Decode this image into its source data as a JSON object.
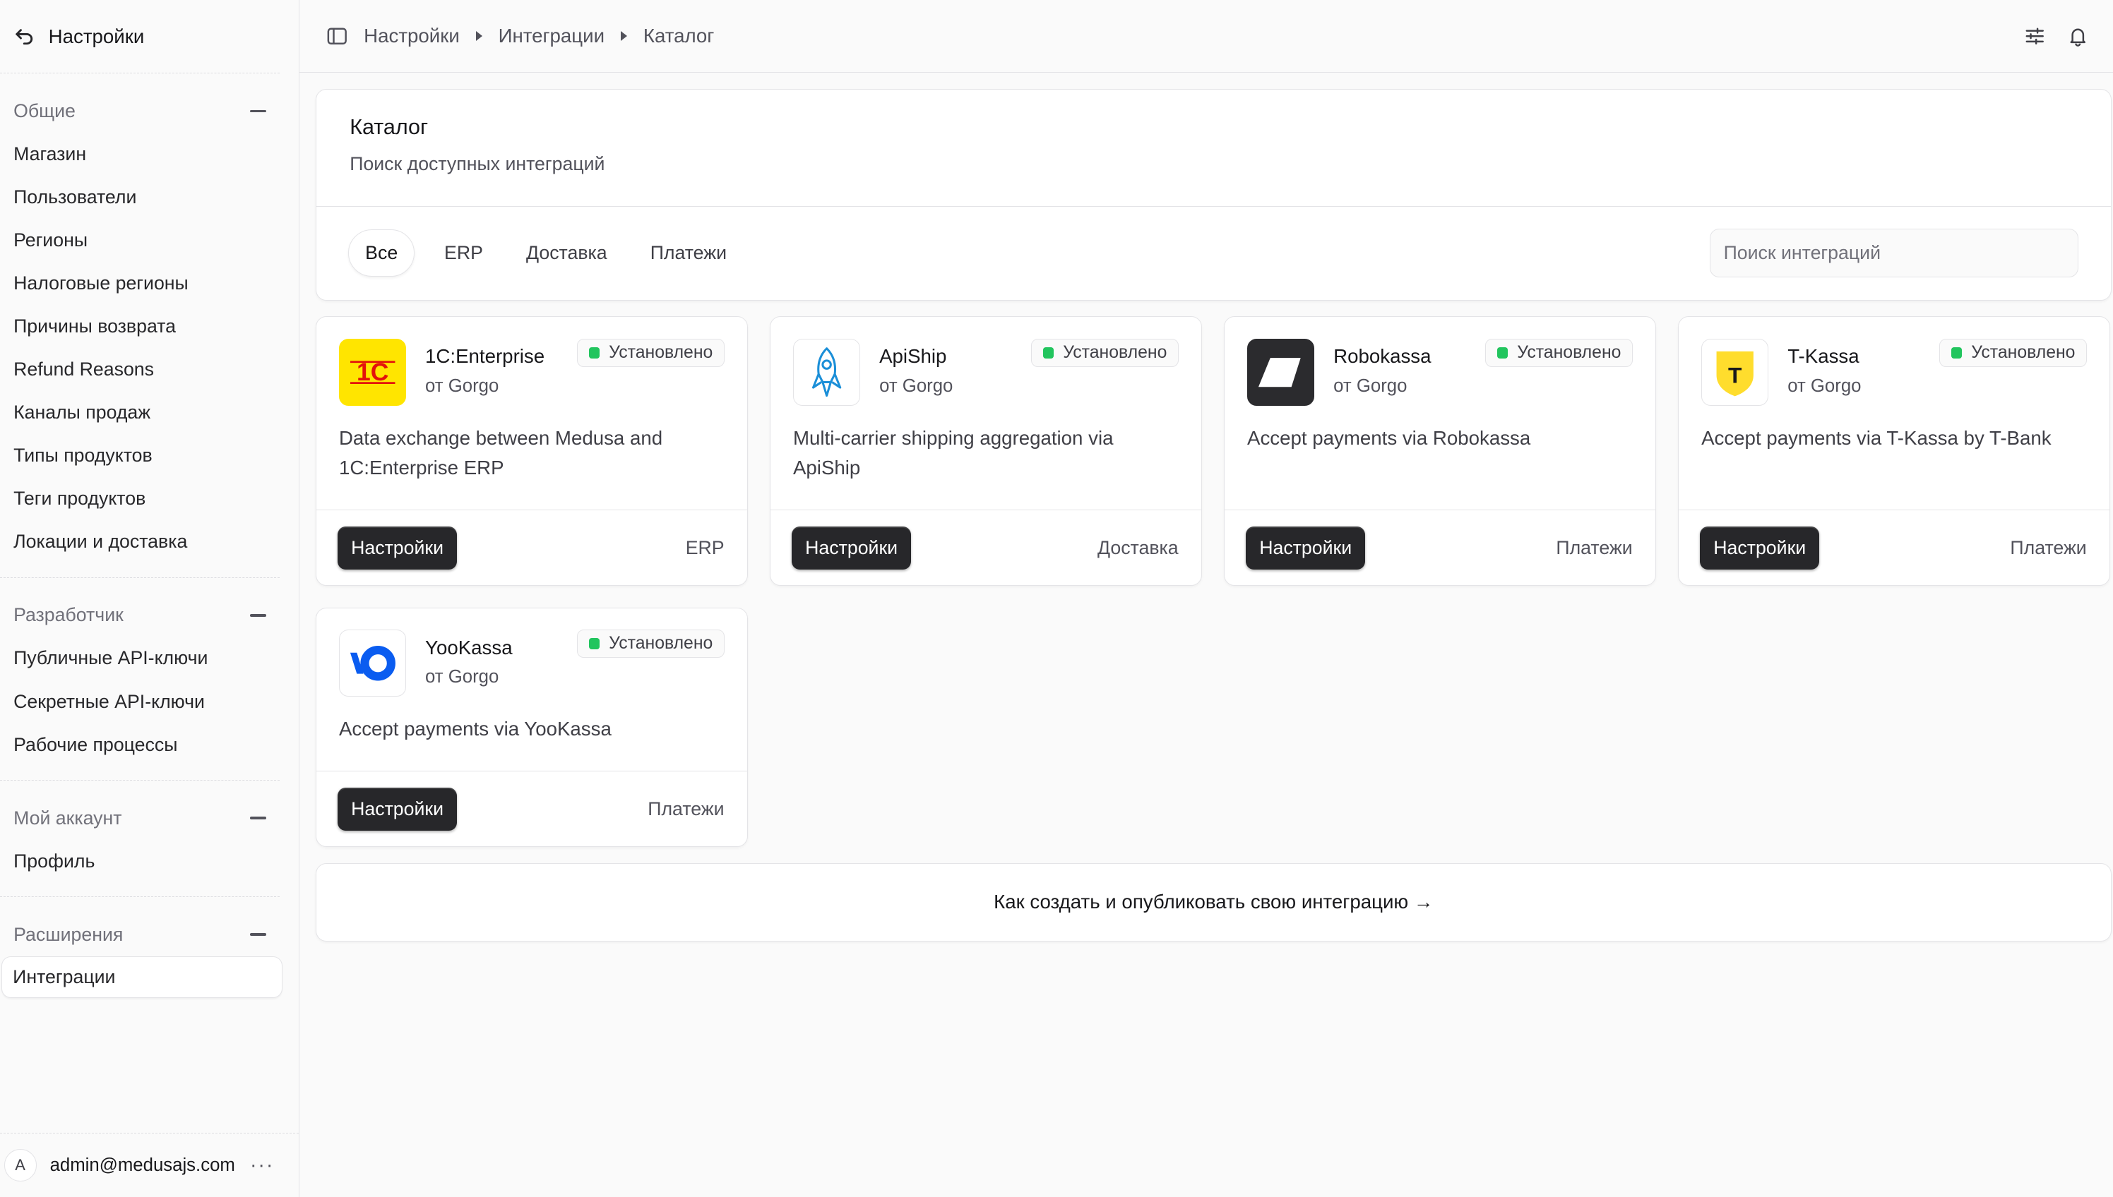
{
  "sidebar": {
    "back_label": "Настройки",
    "sections": [
      {
        "title": "Общие",
        "items": [
          "Магазин",
          "Пользователи",
          "Регионы",
          "Налоговые регионы",
          "Причины возврата",
          "Refund Reasons",
          "Каналы продаж",
          "Типы продуктов",
          "Теги продуктов",
          "Локации и доставка"
        ]
      },
      {
        "title": "Разработчик",
        "items": [
          "Публичные API-ключи",
          "Секретные API-ключи",
          "Рабочие процессы"
        ]
      },
      {
        "title": "Мой аккаунт",
        "items": [
          "Профиль"
        ]
      },
      {
        "title": "Расширения",
        "items": [
          "Интеграции"
        ]
      }
    ],
    "user": {
      "initial": "A",
      "email": "admin@medusajs.com",
      "menu": "···"
    }
  },
  "breadcrumb": [
    "Настройки",
    "Интеграции",
    "Каталог"
  ],
  "header": {
    "title": "Каталог",
    "subtitle": "Поиск доступных интеграций",
    "tabs": [
      "Все",
      "ERP",
      "Доставка",
      "Платежи"
    ],
    "search_placeholder": "Поиск интеграций"
  },
  "integrations": [
    {
      "name": "1C:Enterprise",
      "by": "от Gorgo",
      "status": "Установлено",
      "description": "Data exchange between Medusa and 1C:Enterprise ERP",
      "button": "Настройки",
      "category": "ERP",
      "logo_text": "1С"
    },
    {
      "name": "ApiShip",
      "by": "от Gorgo",
      "status": "Установлено",
      "description": "Multi-carrier shipping aggregation via ApiShip",
      "button": "Настройки",
      "category": "Доставка"
    },
    {
      "name": "Robokassa",
      "by": "от Gorgo",
      "status": "Установлено",
      "description": "Accept payments via Robokassa",
      "button": "Настройки",
      "category": "Платежи"
    },
    {
      "name": "T-Kassa",
      "by": "от Gorgo",
      "status": "Установлено",
      "description": "Accept payments via T-Kassa by T-Bank",
      "button": "Настройки",
      "category": "Платежи",
      "logo_text": "T"
    },
    {
      "name": "YooKassa",
      "by": "от Gorgo",
      "status": "Установлено",
      "description": "Accept payments via YooKassa",
      "button": "Настройки",
      "category": "Платежи"
    }
  ],
  "footer_link": "Как создать и опубликовать свою интеграцию →",
  "colors": {
    "installed": "#22c55e",
    "button": "#27272a",
    "onec_bg": "#ffe500",
    "onec_fg": "#e3120b",
    "yookassa": "#0a5cf0",
    "tkassa": "#ffdd2d"
  }
}
